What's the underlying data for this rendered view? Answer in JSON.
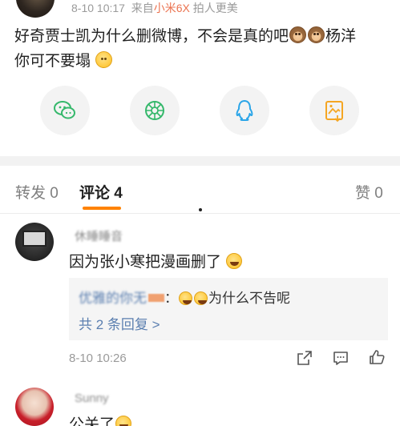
{
  "post": {
    "meta_time": "8-10 10:17",
    "meta_from": "来自",
    "meta_device": "小米6X",
    "meta_tagline": "拍人更美",
    "text_part1": "好奇贾士凯为什么删微博，不会是真的吧",
    "text_part2": "杨洋",
    "text_part3": "你可不要塌"
  },
  "share": {
    "items": [
      {
        "name": "wechat-icon",
        "color": "#35b86b"
      },
      {
        "name": "moments-icon",
        "color": "#35b86b"
      },
      {
        "name": "qq-icon",
        "color": "#2aa5e8"
      },
      {
        "name": "save-image-icon",
        "color": "#f5a623"
      }
    ]
  },
  "tabs": {
    "repost_label": "转发 0",
    "comment_label": "评论 4",
    "like_label": "赞 0",
    "accent": "#ff8200"
  },
  "comments": [
    {
      "author": "休睡睡音",
      "text": "因为张小寒把漫画删了",
      "reply_author": "优雅的你无",
      "reply_text": "为什么不告呢",
      "reply_count": "共 2 条回复 >",
      "time": "8-10 10:26"
    },
    {
      "author": "Sunny",
      "text": "公关了"
    }
  ]
}
